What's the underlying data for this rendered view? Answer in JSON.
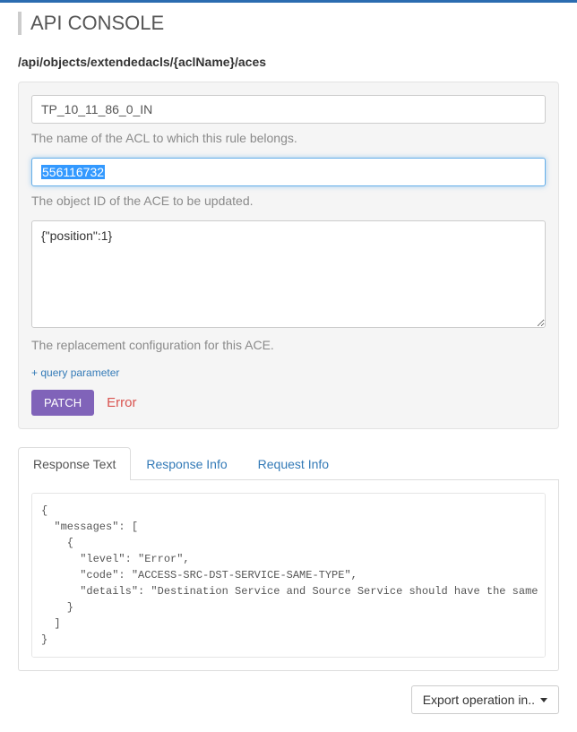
{
  "header": {
    "title": "API CONSOLE"
  },
  "endpoint": "/api/objects/extendedacls/{aclName}/aces",
  "form": {
    "aclName": {
      "value": "TP_10_11_86_0_IN",
      "help": "The name of the ACL to which this rule belongs."
    },
    "objectId": {
      "value": "556116732",
      "help": "The object ID of the ACE to be updated."
    },
    "body": {
      "value": "{\"position\":1}",
      "help": "The replacement configuration for this ACE."
    },
    "queryLink": "+ query parameter",
    "submitLabel": "PATCH",
    "status": "Error"
  },
  "tabs": {
    "responseText": "Response Text",
    "responseInfo": "Response Info",
    "requestInfo": "Request Info"
  },
  "responseBody": "{\n  \"messages\": [\n    {\n      \"level\": \"Error\",\n      \"code\": \"ACCESS-SRC-DST-SERVICE-SAME-TYPE\",\n      \"details\": \"Destination Service and Source Service should have the same protocol\"\n    }\n  ]\n}",
  "export": {
    "label": "Export operation in.."
  }
}
